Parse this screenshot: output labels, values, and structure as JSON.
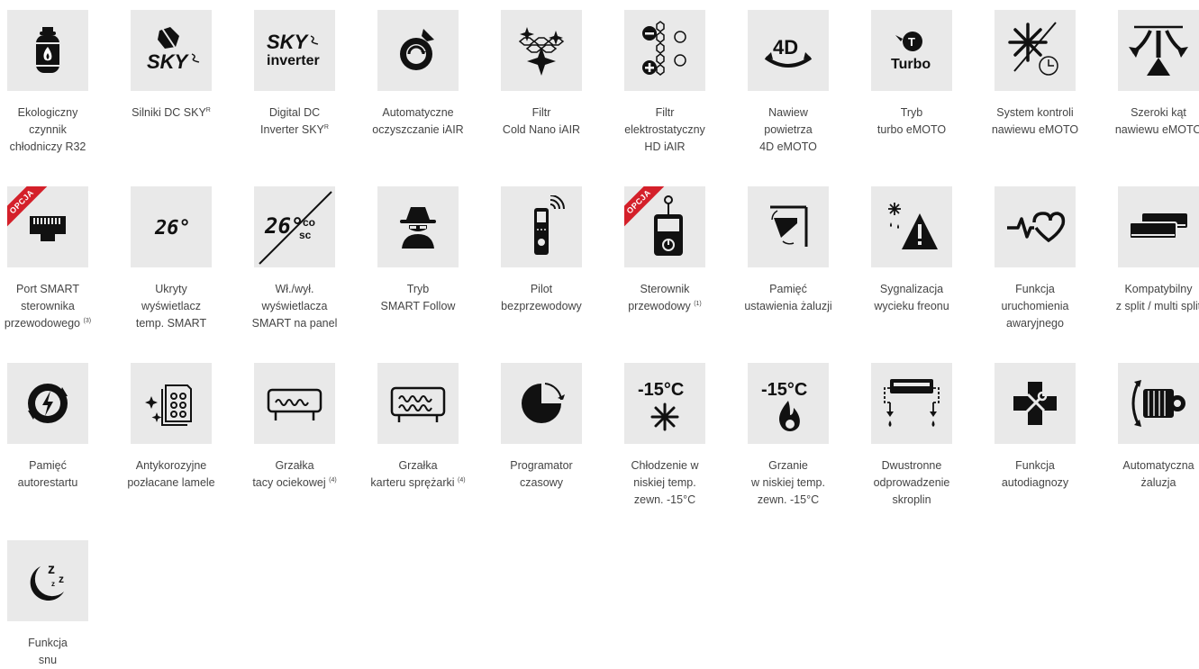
{
  "features": [
    {
      "icon": "gas-cylinder-flame-icon",
      "lines": [
        "Ekologiczny",
        "czynnik",
        "chłodniczy R32"
      ]
    },
    {
      "icon": "sky-dc-motor-icon",
      "icon_text": "SKY",
      "lines": [
        "Silniki DC SKY"
      ],
      "sup": "R"
    },
    {
      "icon": "sky-inverter-icon",
      "icon_text": "SKY",
      "icon_text2": "inverter",
      "lines": [
        "Digital DC",
        "Inverter SKY"
      ],
      "sup": "R"
    },
    {
      "icon": "auto-clean-icon",
      "lines": [
        "Automatyczne",
        "oczyszczanie iAIR"
      ]
    },
    {
      "icon": "cold-nano-filter-icon",
      "lines": [
        "Filtr",
        "Cold Nano iAIR"
      ]
    },
    {
      "icon": "electrostatic-filter-icon",
      "lines": [
        "Filtr",
        "elektrostatyczny",
        "HD iAIR"
      ]
    },
    {
      "icon": "4d-airflow-icon",
      "icon_text": "4D",
      "lines": [
        "Nawiew",
        "powietrza",
        "4D eMOTO"
      ]
    },
    {
      "icon": "turbo-icon",
      "icon_text": "T",
      "icon_text2": "Turbo",
      "lines": [
        "Tryb",
        "turbo eMOTO"
      ]
    },
    {
      "icon": "airflow-control-timer-icon",
      "lines": [
        "System kontroli",
        "nawiewu eMOTO"
      ]
    },
    {
      "icon": "wide-angle-airflow-icon",
      "lines": [
        "Szeroki kąt",
        "nawiewu eMOTO"
      ]
    },
    {
      "icon": "smart-port-icon",
      "badge": "OPCJA",
      "lines": [
        "Port SMART",
        "sterownika",
        "przewodowego"
      ],
      "sup": "(3)"
    },
    {
      "icon": "hidden-display-icon",
      "icon_text": "26°",
      "lines": [
        "Ukryty",
        "wyświetlacz",
        "temp. SMART"
      ]
    },
    {
      "icon": "display-toggle-icon",
      "icon_text": "26°",
      "icon_text2": "co",
      "icon_text3": "sc",
      "lines": [
        "Wł./wył.",
        "wyświetlacza",
        "SMART na panel"
      ]
    },
    {
      "icon": "smart-follow-spy-icon",
      "lines": [
        "Tryb",
        "SMART Follow"
      ]
    },
    {
      "icon": "wireless-remote-icon",
      "lines": [
        "Pilot",
        "bezprzewodowy"
      ]
    },
    {
      "icon": "wired-controller-icon",
      "badge": "OPCJA",
      "lines": [
        "Sterownik",
        "przewodowy"
      ],
      "sup": "(1)"
    },
    {
      "icon": "louver-memory-icon",
      "lines": [
        "Pamięć",
        "ustawienia żaluzji"
      ]
    },
    {
      "icon": "refrigerant-leak-warning-icon",
      "lines": [
        "Sygnalizacja",
        "wycieku freonu"
      ]
    },
    {
      "icon": "emergency-start-heart-icon",
      "lines": [
        "Funkcja",
        "uruchomienia",
        "awaryjnego"
      ]
    },
    {
      "icon": "split-multisplit-icon",
      "lines": [
        "Kompatybilny",
        "z split / multi split"
      ]
    },
    {
      "icon": "auto-restart-icon",
      "lines": [
        "Pamięć",
        "autorestartu"
      ]
    },
    {
      "icon": "gold-fins-icon",
      "lines": [
        "Antykorozyjne",
        "pozłacane lamele"
      ]
    },
    {
      "icon": "drain-pan-heater-icon",
      "lines": [
        "Grzałka",
        "tacy ociekowej"
      ],
      "sup": "(4)"
    },
    {
      "icon": "crankcase-heater-icon",
      "lines": [
        "Grzałka",
        "karteru sprężarki"
      ],
      "sup": "(4)"
    },
    {
      "icon": "timer-pie-icon",
      "lines": [
        "Programator",
        "czasowy"
      ]
    },
    {
      "icon": "low-temp-cooling-icon",
      "icon_text": "-15°C",
      "lines": [
        "Chłodzenie w",
        "niskiej temp.",
        "zewn. -15°C"
      ]
    },
    {
      "icon": "low-temp-heating-icon",
      "icon_text": "-15°C",
      "lines": [
        "Grzanie",
        "w niskiej temp.",
        "zewn. -15°C"
      ]
    },
    {
      "icon": "dual-drain-icon",
      "lines": [
        "Dwustronne",
        "odprowadzenie",
        "skroplin"
      ]
    },
    {
      "icon": "self-diagnosis-icon",
      "lines": [
        "Funkcja",
        "autodiagnozy"
      ]
    },
    {
      "icon": "auto-louver-icon",
      "lines": [
        "Automatyczna",
        "żaluzja"
      ]
    },
    {
      "icon": "sleep-moon-icon",
      "icon_text": "z",
      "lines": [
        "Funkcja",
        "snu"
      ]
    }
  ]
}
